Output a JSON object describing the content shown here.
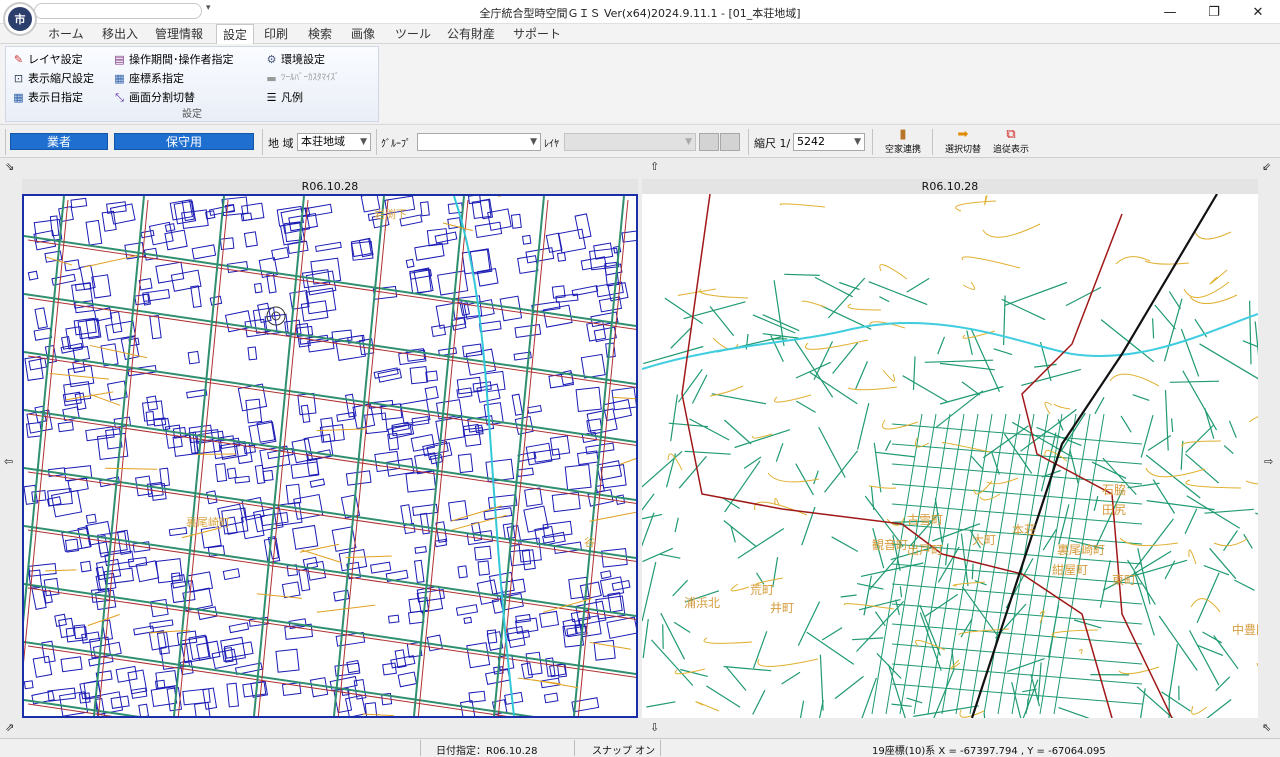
{
  "window": {
    "title": "全庁統合型時空間ＧＩＳ Ver(x64)2024.9.11.1 - [01_本荘地域]",
    "logo_text": "市",
    "min": "—",
    "max": "❐",
    "close": "✕"
  },
  "menu": {
    "tabs": [
      "ホーム",
      "移出入",
      "管理情報",
      "設定",
      "印刷",
      "検索",
      "画像",
      "ツール",
      "公有財産",
      "サポート"
    ],
    "active": "設定"
  },
  "ribbon": {
    "group_label": "設定",
    "layer_settings": "レイヤ設定",
    "display_scale": "表示縮尺設定",
    "display_date": "表示日指定",
    "operation_period": "操作期間･操作者指定",
    "coordinate_system": "座標系指定",
    "split_screen": "画面分割切替",
    "environment": "環境設定",
    "toolbar_customize": "ﾂｰﾙﾊﾞｰｶｽﾀﾏｲｽﾞ",
    "legend": "凡例"
  },
  "toolbar": {
    "vendor_btn": "業者",
    "maintenance_btn": "保守用",
    "region_label": "地 域",
    "region_value": "本荘地域",
    "group_label": "ｸﾞﾙｰﾌﾟ",
    "group_value": "",
    "layer_label": "ﾚｲﾔ",
    "layer_value": "",
    "scale_label": "縮尺 1/",
    "scale_value": "5242",
    "vacant_house": "空家連携",
    "select_switch": "選択切替",
    "follow_display": "追従表示"
  },
  "map": {
    "left_date": "R06.10.28",
    "right_date": "R06.10.28",
    "right_labels": [
      "古雪町",
      "観音町",
      "出戸町",
      "浦浜北",
      "大町",
      "本荘",
      "紺屋町",
      "井町",
      "荒町",
      "東町",
      "田尻",
      "裏尾崎町",
      "石脇",
      "中豊岡"
    ],
    "left_labels": [
      "岩渕下",
      "裏尾崎町",
      "谷"
    ]
  },
  "status": {
    "date_spec": "日付指定：R06.10.28",
    "snap": "スナップ オン",
    "coords": "19座標(10)系  X = -67397.794 , Y = -67064.095"
  }
}
